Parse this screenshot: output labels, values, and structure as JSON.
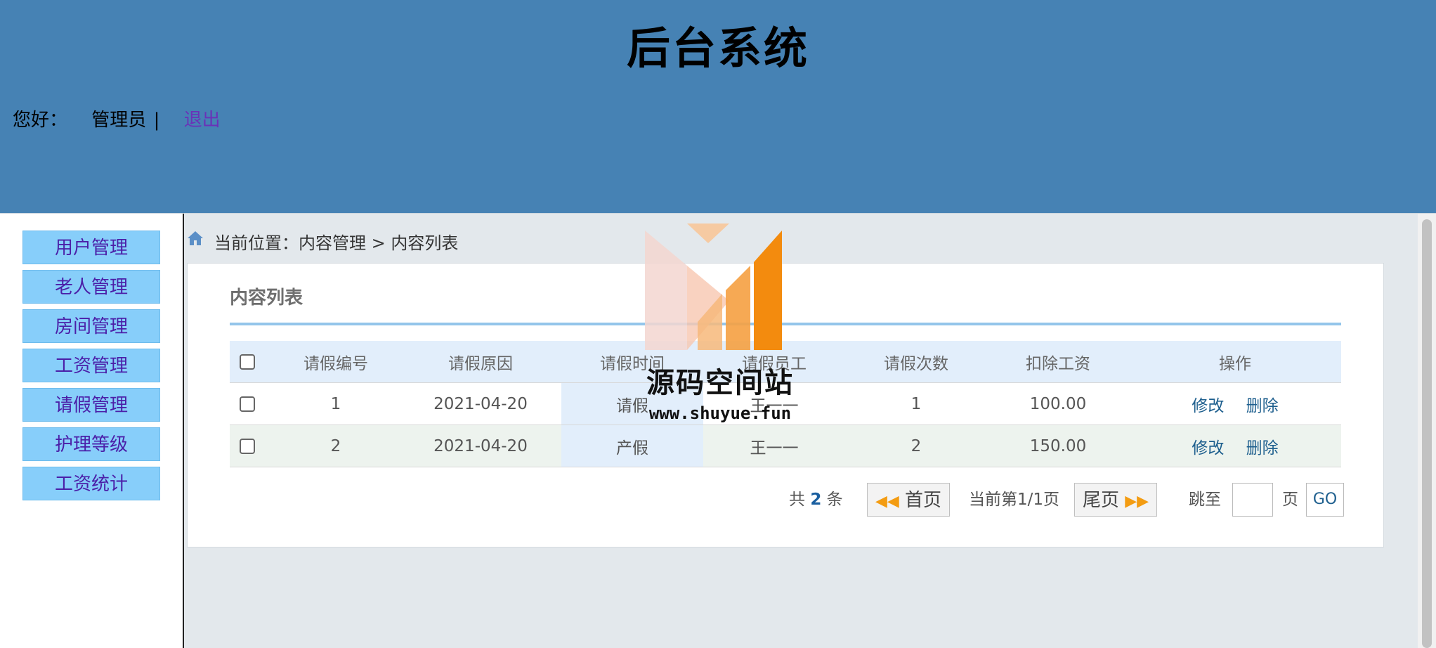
{
  "header": {
    "title": "后台系统",
    "greeting": "您好：",
    "username": "管理员",
    "separator": "|",
    "logout": "退出"
  },
  "sidebar": {
    "items": [
      {
        "label": "用户管理"
      },
      {
        "label": "老人管理"
      },
      {
        "label": "房间管理"
      },
      {
        "label": "工资管理"
      },
      {
        "label": "请假管理"
      },
      {
        "label": "护理等级"
      },
      {
        "label": "工资统计"
      }
    ]
  },
  "breadcrumb": {
    "text": "当前位置：内容管理 > 内容列表"
  },
  "card": {
    "title": "内容列表"
  },
  "table": {
    "columns": [
      "请假编号",
      "请假原因",
      "请假时间",
      "请假员工",
      "请假次数",
      "扣除工资",
      "操作"
    ],
    "rows": [
      {
        "id": "1",
        "reason": "2021-04-20",
        "time": "请假",
        "employee": "王一一",
        "count": "1",
        "deduction": "100.00"
      },
      {
        "id": "2",
        "reason": "2021-04-20",
        "time": "产假",
        "employee": "王一一",
        "count": "2",
        "deduction": "150.00"
      }
    ],
    "actions": {
      "edit": "修改",
      "delete": "删除"
    }
  },
  "pagination": {
    "total_prefix": "共",
    "total": "2",
    "total_suffix": "条",
    "first": "首页",
    "current": "当前第1/1页",
    "last": "尾页",
    "jump_label": "跳至",
    "page_label": "页",
    "jump_value": "",
    "go": "GO"
  },
  "watermark": {
    "title": "源码空间站",
    "url": "www.shuyue.fun"
  },
  "colors": {
    "header_bg": "#4682b4",
    "menu_bg": "#87cefa",
    "menu_text": "#4b1fa8",
    "logout_text": "#6a32b8",
    "table_header_bg": "#e2eefb",
    "accent_line": "#94c5ea"
  },
  "icons": {
    "breadcrumb": "home-icon",
    "first_page": "double-left-arrow-icon",
    "last_page": "double-right-arrow-icon",
    "watermark_logo": "bar-chart-logo-icon"
  }
}
